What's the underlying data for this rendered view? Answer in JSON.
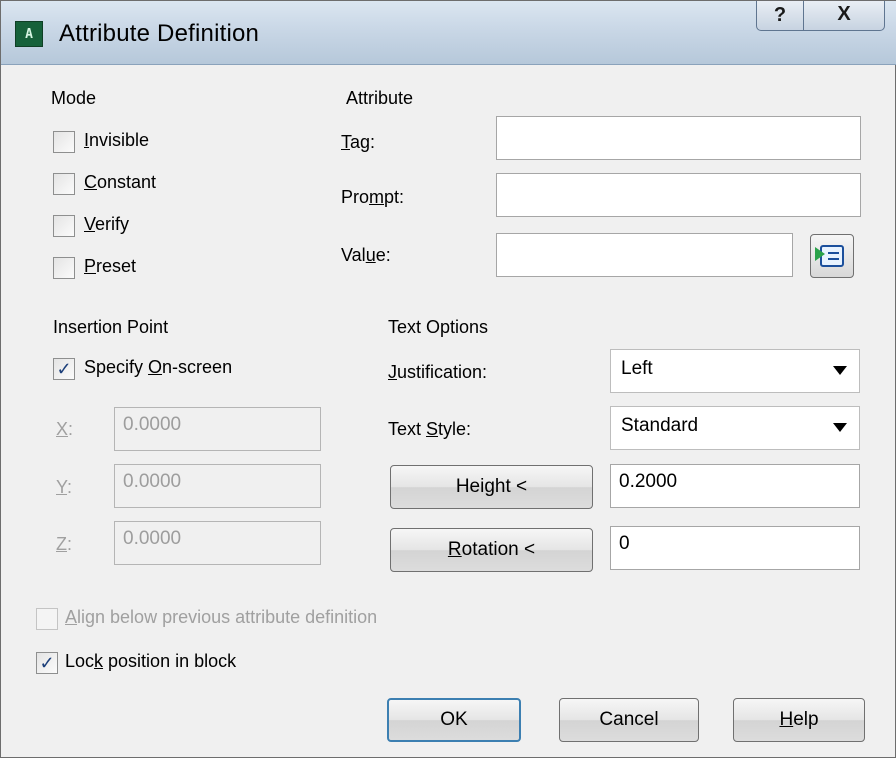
{
  "window": {
    "title": "Attribute Definition",
    "help_glyph": "?",
    "close_glyph": "X",
    "app_icon": "attribute-definition-icon"
  },
  "mode": {
    "heading": "Mode",
    "invisible": {
      "key": "I",
      "rest": "nvisible",
      "checked": false
    },
    "constant": {
      "key": "C",
      "rest": "onstant",
      "checked": false
    },
    "verify": {
      "key": "V",
      "rest": "erify",
      "checked": false
    },
    "preset": {
      "key": "P",
      "rest": "reset",
      "checked": false
    }
  },
  "attribute": {
    "heading": "Attribute",
    "tag": {
      "pre": "",
      "key": "T",
      "post": "ag:",
      "value": ""
    },
    "prompt": {
      "pre": "Pro",
      "key": "m",
      "post": "pt:",
      "value": ""
    },
    "value": {
      "pre": "Val",
      "key": "u",
      "post": "e:",
      "value": ""
    },
    "insert_field_icon": "insert-field-icon"
  },
  "insertion_point": {
    "heading": "Insertion Point",
    "specify": {
      "pre": "Specify ",
      "key": "O",
      "post": "n-screen",
      "checked": true
    },
    "x": {
      "key": "X",
      "post": ":",
      "value": "0.0000"
    },
    "y": {
      "key": "Y",
      "post": ":",
      "value": "0.0000"
    },
    "z": {
      "key": "Z",
      "post": ":",
      "value": "0.0000"
    }
  },
  "text_options": {
    "heading": "Text Options",
    "justification": {
      "key": "J",
      "post": "ustification:",
      "value": "Left"
    },
    "text_style": {
      "pre": "Text ",
      "key": "S",
      "post": "tyle:",
      "value": "Standard"
    },
    "height": {
      "pre": "Hei",
      "key": "g",
      "post": "ht <",
      "value": "0.2000"
    },
    "rotation": {
      "key": "R",
      "post": "otation <",
      "value": "0"
    }
  },
  "align_below": {
    "key": "A",
    "post": "lign below previous attribute definition",
    "checked": false,
    "enabled": false
  },
  "lock_position": {
    "pre": "Loc",
    "key": "k",
    "post": " position in block",
    "checked": true
  },
  "buttons": {
    "ok": "OK",
    "cancel": "Cancel",
    "help": {
      "key": "H",
      "post": "elp"
    }
  },
  "colors": {
    "title_gradient_top": "#dbe6f1",
    "title_gradient_bottom": "#b6c8da",
    "dialog_bg": "#f0f0f0",
    "check_mark": "#1c3f7a",
    "default_button_border": "#3c7fb1",
    "disabled_text": "#a0a0a0"
  }
}
